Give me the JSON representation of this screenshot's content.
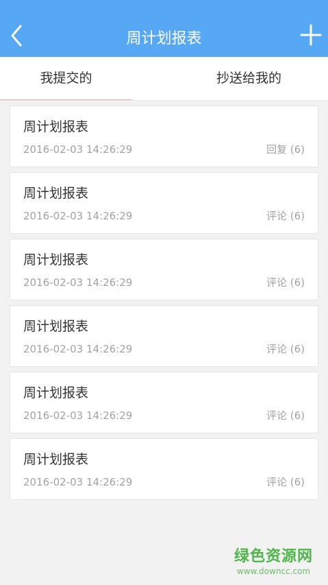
{
  "header": {
    "title": "周计划报表",
    "back_icon": "chevron-left-icon",
    "add_icon": "plus-icon",
    "background": "#56a8f4"
  },
  "tabs": [
    {
      "label": "我提交的",
      "active": true
    },
    {
      "label": "抄送给我的",
      "active": false
    }
  ],
  "items": [
    {
      "title": "周计划报表",
      "date": "2016-02-03 14:26:29",
      "meta": "回复 (6)"
    },
    {
      "title": "周计划报表",
      "date": "2016-02-03 14:26:29",
      "meta": "评论 (6)"
    },
    {
      "title": "周计划报表",
      "date": "2016-02-03 14:26:29",
      "meta": "评论 (6)"
    },
    {
      "title": "周计划报表",
      "date": "2016-02-03 14:26:29",
      "meta": "评论 (6)"
    },
    {
      "title": "周计划报表",
      "date": "2016-02-03 14:26:29",
      "meta": "评论 (6)"
    },
    {
      "title": "周计划报表",
      "date": "2016-02-03 14:26:29",
      "meta": "评论 (6)"
    }
  ],
  "watermark": {
    "main": "绿色资源网",
    "url": "www.downcc.com"
  }
}
